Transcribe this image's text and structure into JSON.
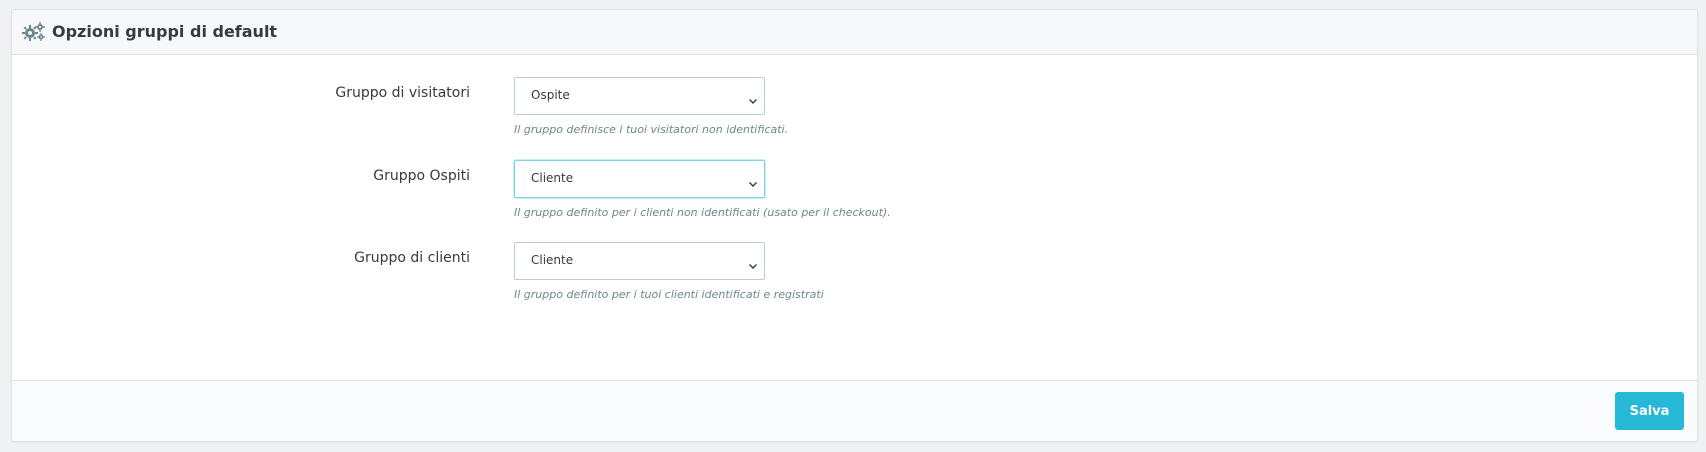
{
  "panel": {
    "title": "Opzioni gruppi di default",
    "icon": "gears-icon"
  },
  "form": {
    "fields": [
      {
        "label": "Gruppo di visitatori",
        "selected": "Ospite",
        "help": "Il gruppo definisce i tuoi visitatori non identificati."
      },
      {
        "label": "Gruppo Ospiti",
        "selected": "Cliente",
        "help": "Il gruppo definito per i clienti non identificati (usato per il checkout)."
      },
      {
        "label": "Gruppo di clienti",
        "selected": "Cliente",
        "help": "Il gruppo definito per i tuoi clienti identificati e registrati"
      }
    ]
  },
  "footer": {
    "save_label": "Salva"
  },
  "colors": {
    "accent": "#25b9d7",
    "focus_border": "#7cd5e7",
    "text": "#363a41",
    "help_text": "#6c868e"
  }
}
